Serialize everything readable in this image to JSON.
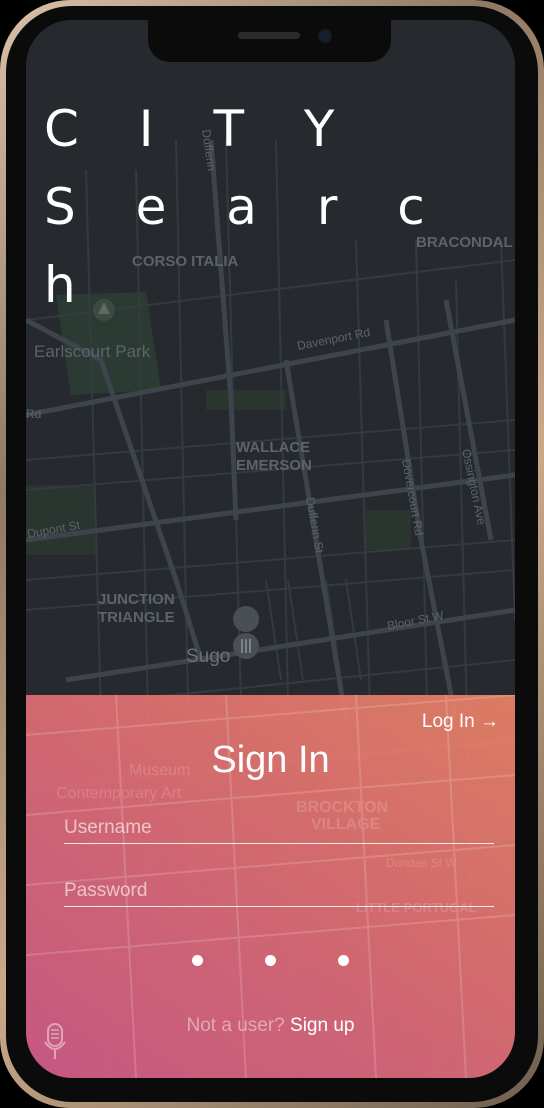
{
  "app": {
    "brand_line1": "C I T Y",
    "brand_line2": "S e a r c h"
  },
  "map": {
    "labels": {
      "corso_italia": "CORSO ITALIA",
      "earlscourt_park": "Earlscourt Park",
      "davenport_rd": "Davenport Rd",
      "wallace_emerson_1": "WALLACE",
      "wallace_emerson_2": "EMERSON",
      "dufferin_st": "Dufferin St",
      "dovercourt_rd": "Dovercourt Rd",
      "ossington_ave": "Ossington Ave",
      "dupont_st": "Dupont St",
      "junction_triangle_1": "JUNCTION",
      "junction_triangle_2": "TRIANGLE",
      "bloor_st_w": "Bloor St W",
      "sugo": "Sugo",
      "bracondale": "BRACONDAL",
      "rd_left": "Rd",
      "dufferin_top": "Dufferin",
      "museum_1": "Museum",
      "museum_2": "Contemporary Art",
      "brockton_1": "BROCKTON",
      "brockton_2": "VILLAGE",
      "dundas_st_w": "Dundas St W",
      "little_portugal": "LITTLE PORTUGAL"
    }
  },
  "signin": {
    "login_link": "Log In →",
    "title": "Sign In",
    "username_placeholder": "Username",
    "password_placeholder": "Password",
    "footer_prompt": "Not a user?",
    "footer_link": "Sign up"
  },
  "colors": {
    "map_background": "#262a2f",
    "panel_gradient_top": "#e98266",
    "panel_gradient_bottom": "#cd5a87",
    "text": "#ffffff"
  },
  "icons": {
    "park": "tree-pin-icon",
    "restaurant": "fork-knife-pin-icon",
    "mic": "microphone-icon"
  }
}
